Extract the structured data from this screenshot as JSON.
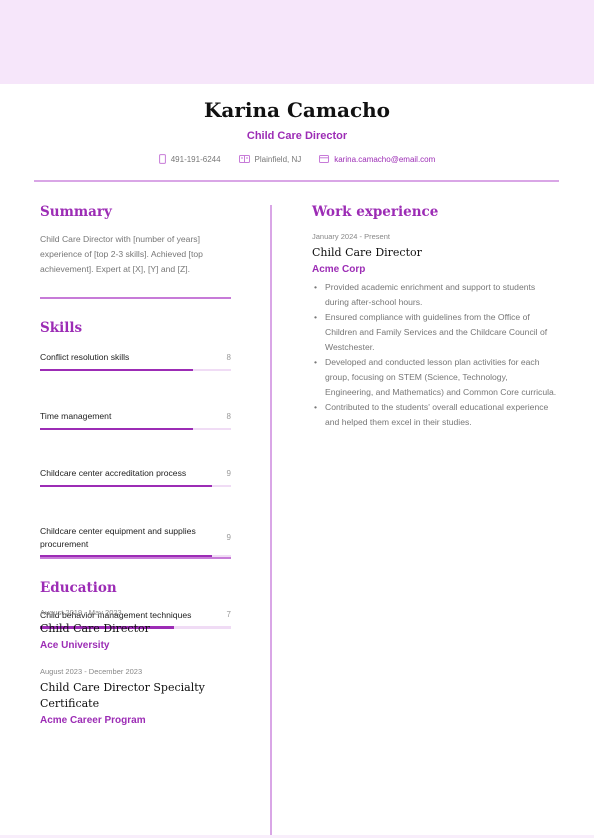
{
  "header": {
    "name": "Karina Camacho",
    "headline": "Child Care Director",
    "contacts": [
      {
        "icon": "phone-icon",
        "text": "491-191-6244"
      },
      {
        "icon": "id-card-icon",
        "text": "Plainfield, NJ"
      },
      {
        "icon": "mail-icon",
        "text": "karina.camacho@email.com"
      }
    ]
  },
  "colors": {
    "accent": "#9c2cb5",
    "band": "#f6e6fa",
    "divider": "#d9a6e6",
    "bar_track": "#f0dcf5"
  },
  "summary": {
    "title": "Summary",
    "text": "Child Care Director with [number of years] experience of [top 2-3 skills]. Achieved [top achievement]. Expert at [X], [Y] and [Z]."
  },
  "skills": {
    "title": "Skills",
    "max": 10,
    "items": [
      {
        "name": "Conflict resolution skills",
        "value": 8
      },
      {
        "name": "Time management",
        "value": 8
      },
      {
        "name": "Childcare center accreditation process",
        "value": 9
      },
      {
        "name": "Childcare center equipment and supplies procurement",
        "value": 9
      },
      {
        "name": "Child behavior management techniques",
        "value": 7
      }
    ]
  },
  "education": {
    "title": "Education",
    "items": [
      {
        "dates": "August 2019 - May 2023",
        "degree": "Child Care Director",
        "school": "Ace University"
      },
      {
        "dates": "August 2023 - December 2023",
        "degree": "Child Care Director Specialty Certificate",
        "school": "Acme Career Program"
      }
    ]
  },
  "work": {
    "title": "Work experience",
    "items": [
      {
        "dates": "January 2024 - Present",
        "role": "Child Care Director",
        "company": "Acme Corp",
        "bullets": [
          "Provided academic enrichment and support to students during after-school hours.",
          "Ensured compliance with guidelines from the Office of Children and Family Services and the Childcare Council of Westchester.",
          "Developed and conducted lesson plan activities for each group, focusing on STEM (Science, Technology, Engineering, and Mathematics) and Common Core curricula.",
          "Contributed to the students' overall educational experience and helped them excel in their studies."
        ]
      }
    ]
  }
}
